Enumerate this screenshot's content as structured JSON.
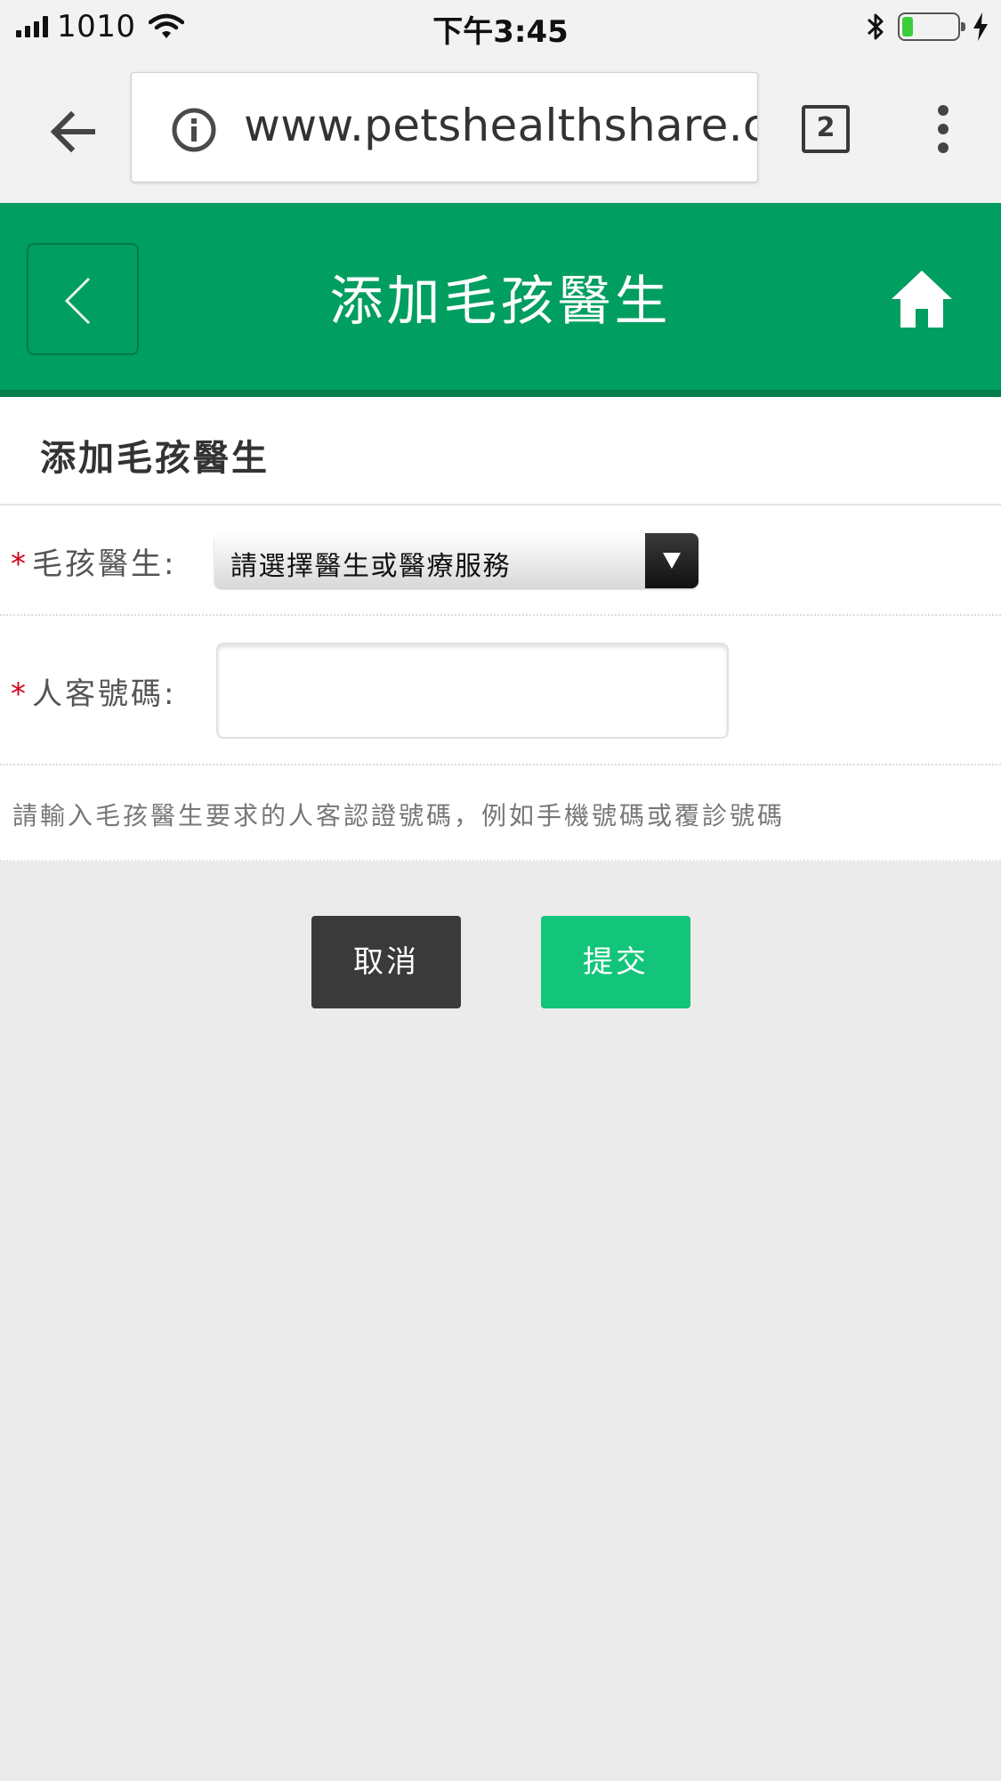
{
  "status_bar": {
    "carrier": "1010",
    "time": "下午3:45",
    "battery_level": 0.2
  },
  "browser": {
    "url": "www.petshealthshare.com",
    "tab_count": "2"
  },
  "header": {
    "title": "添加毛孩醫生"
  },
  "form": {
    "section_title": "添加毛孩醫生",
    "required_mark": "*",
    "doctor_label": "毛孩醫生:",
    "doctor_select_value": "請選擇醫生或醫療服務",
    "customer_number_label": "人客號碼:",
    "customer_number_value": "",
    "hint": "請輸入毛孩醫生要求的人客認證號碼，例如手機號碼或覆診號碼"
  },
  "buttons": {
    "cancel": "取消",
    "submit": "提交"
  },
  "colors": {
    "header_green": "#009e60",
    "submit_green": "#12c57a",
    "cancel_dark": "#3a3a3a",
    "required_red": "#d0021b"
  }
}
